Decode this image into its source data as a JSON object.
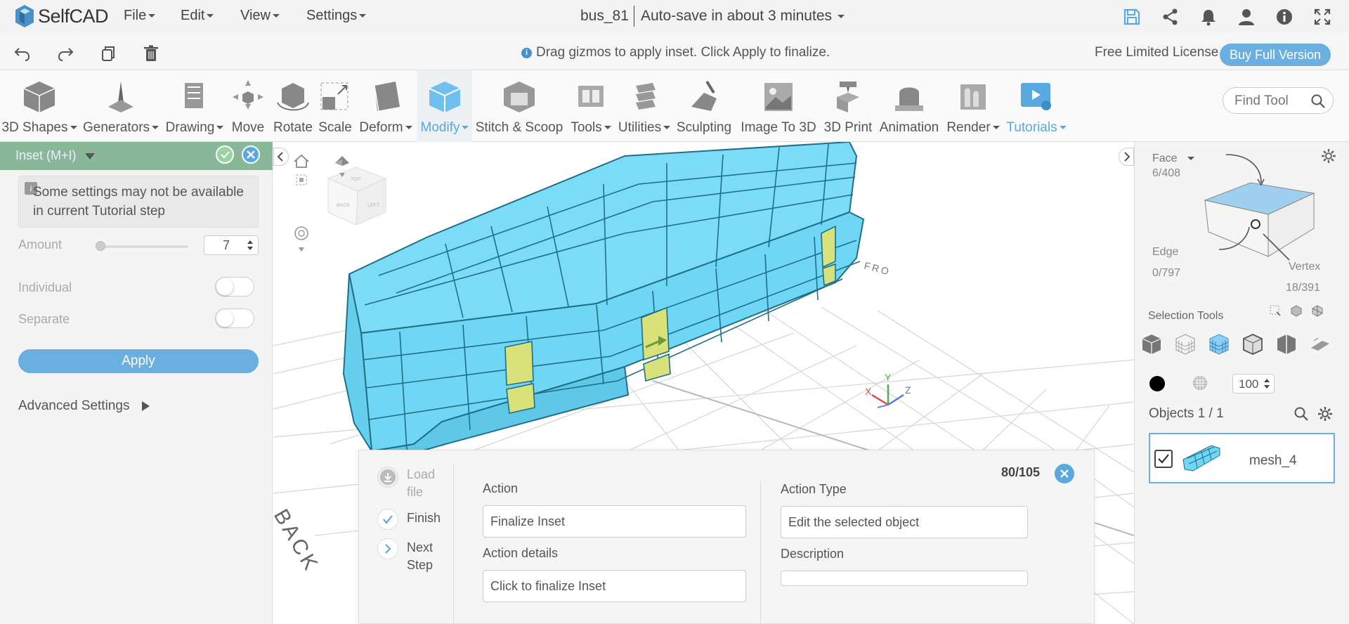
{
  "app": {
    "logo_text": "SelfCAD",
    "menus": [
      "File",
      "Edit",
      "View",
      "Settings"
    ],
    "file_name": "bus_81",
    "autosave": "Auto-save in about 3 minutes"
  },
  "bar2": {
    "hint": "Drag gizmos to apply inset. Click Apply to finalize.",
    "license": "Free Limited License",
    "buy_button": "Buy Full Version"
  },
  "toolbar": {
    "tools": [
      {
        "label": "3D Shapes",
        "dropdown": true
      },
      {
        "label": "Generators",
        "dropdown": true
      },
      {
        "label": "Drawing",
        "dropdown": true
      },
      {
        "label": "Move",
        "dropdown": false
      },
      {
        "label": "Rotate",
        "dropdown": false
      },
      {
        "label": "Scale",
        "dropdown": false
      },
      {
        "label": "Deform",
        "dropdown": true
      },
      {
        "label": "Modify",
        "dropdown": true,
        "active": true
      },
      {
        "label": "Stitch & Scoop",
        "dropdown": false
      },
      {
        "label": "Tools",
        "dropdown": true
      },
      {
        "label": "Utilities",
        "dropdown": true
      },
      {
        "label": "Sculpting",
        "dropdown": false
      },
      {
        "label": "Image To 3D",
        "dropdown": false
      },
      {
        "label": "3D Print",
        "dropdown": false
      },
      {
        "label": "Animation",
        "dropdown": false
      },
      {
        "label": "Render",
        "dropdown": true
      },
      {
        "label": "Tutorials",
        "dropdown": true,
        "accent": true
      }
    ],
    "find_tool_placeholder": "Find Tool"
  },
  "left_panel": {
    "title": "Inset (M+I)",
    "note": "Some settings may not be available in current Tutorial step",
    "amount_label": "Amount",
    "amount_value": "7",
    "individual_label": "Individual",
    "individual_on": false,
    "separate_label": "Separate",
    "separate_on": false,
    "apply_label": "Apply",
    "advanced_label": "Advanced Settings"
  },
  "viewport": {
    "cube_faces": [
      "TOP",
      "BACK",
      "LEFT"
    ],
    "axes": [
      "X",
      "Y",
      "Z"
    ],
    "grid_text_front": "FRO",
    "grid_text_back": "BACK"
  },
  "right_panel": {
    "face_label": "Face",
    "face_count": "6/408",
    "edge_label": "Edge",
    "edge_count": "0/797",
    "vertex_label": "Vertex",
    "vertex_count": "18/391",
    "selection_tools": "Selection Tools",
    "opacity_value": "100",
    "objects_label": "Objects 1 / 1",
    "object_name": "mesh_4",
    "object_checked": true
  },
  "tutorial": {
    "steps": [
      {
        "label": "Load file",
        "state": "disabled"
      },
      {
        "label": "Finish",
        "state": "done"
      },
      {
        "label": "Next Step",
        "state": "next"
      }
    ],
    "progress": "80/105",
    "action_label": "Action",
    "action_value": "Finalize Inset",
    "action_details_label": "Action details",
    "action_details_value": "Click to finalize Inset",
    "action_type_label": "Action Type",
    "action_type_value": "Edit the selected object",
    "description_label": "Description",
    "description_value": ""
  },
  "colors": {
    "accent": "#5aa8e0",
    "mesh": "#6fd6f5",
    "mesh_edge": "#1f6f86",
    "selected_face": "#d9e27a",
    "panel_header": "#89b79a"
  }
}
